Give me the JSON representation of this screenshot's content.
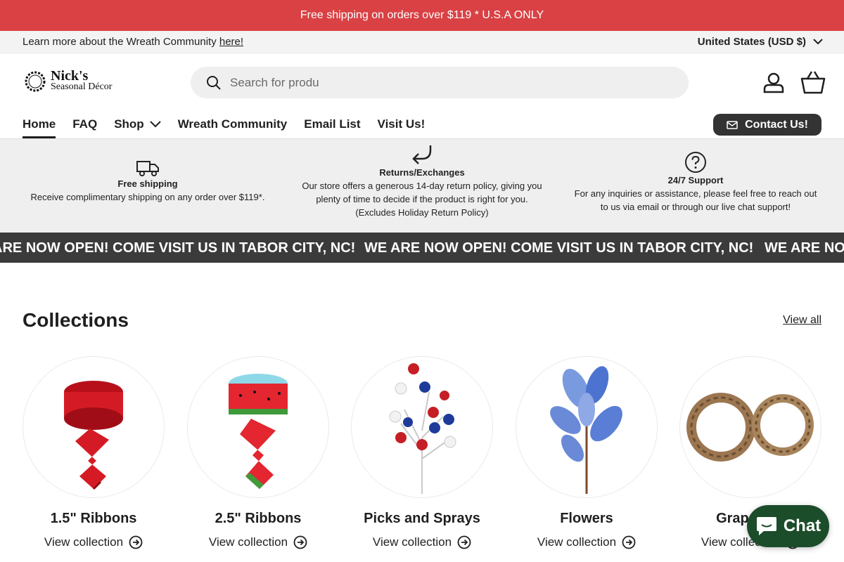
{
  "announcement": {
    "text": "Free shipping on orders over $119 * U.S.A ONLY"
  },
  "utility": {
    "learn_text": "Learn more about the Wreath Community",
    "learn_link": "here!",
    "country": "United States (USD $)"
  },
  "brand": {
    "line1": "Nick's",
    "line2": "Seasonal Décor"
  },
  "search": {
    "placeholder": "Search for produ"
  },
  "nav": {
    "items": [
      {
        "label": "Home"
      },
      {
        "label": "FAQ"
      },
      {
        "label": "Shop"
      },
      {
        "label": "Wreath Community"
      },
      {
        "label": "Email List"
      },
      {
        "label": "Visit Us!"
      }
    ],
    "contact_label": "Contact Us!"
  },
  "features": [
    {
      "icon": "truck-icon",
      "title": "Free shipping",
      "desc": "Receive complimentary shipping on any order over $119*."
    },
    {
      "icon": "return-arrow-icon",
      "title": "Returns/Exchanges",
      "desc": "Our store offers a generous 14-day return policy, giving you plenty of time to decide if the product is right for you.",
      "note": "(Excludes Holiday Return Policy)"
    },
    {
      "icon": "question-icon",
      "title": "24/7 Support",
      "desc": "For any inquiries or assistance, please feel free to reach out to us via email or through our live chat support!"
    }
  ],
  "marquee": {
    "text": "WE ARE NOW OPEN! COME VISIT US IN TABOR CITY, NC!"
  },
  "collections": {
    "title": "Collections",
    "view_all": "View all",
    "cards": [
      {
        "name": "1.5\" Ribbons",
        "link": "View collection"
      },
      {
        "name": "2.5\" Ribbons",
        "link": "View collection"
      },
      {
        "name": "Picks and Sprays",
        "link": "View collection"
      },
      {
        "name": "Flowers",
        "link": "View collection"
      },
      {
        "name": "Grapevine",
        "link": "View collection"
      }
    ]
  },
  "chat": {
    "label": "Chat"
  },
  "colors": {
    "announce_bg": "#d94144",
    "marquee_bg": "#3b3b3b",
    "chat_bg": "#1c4d2b"
  }
}
